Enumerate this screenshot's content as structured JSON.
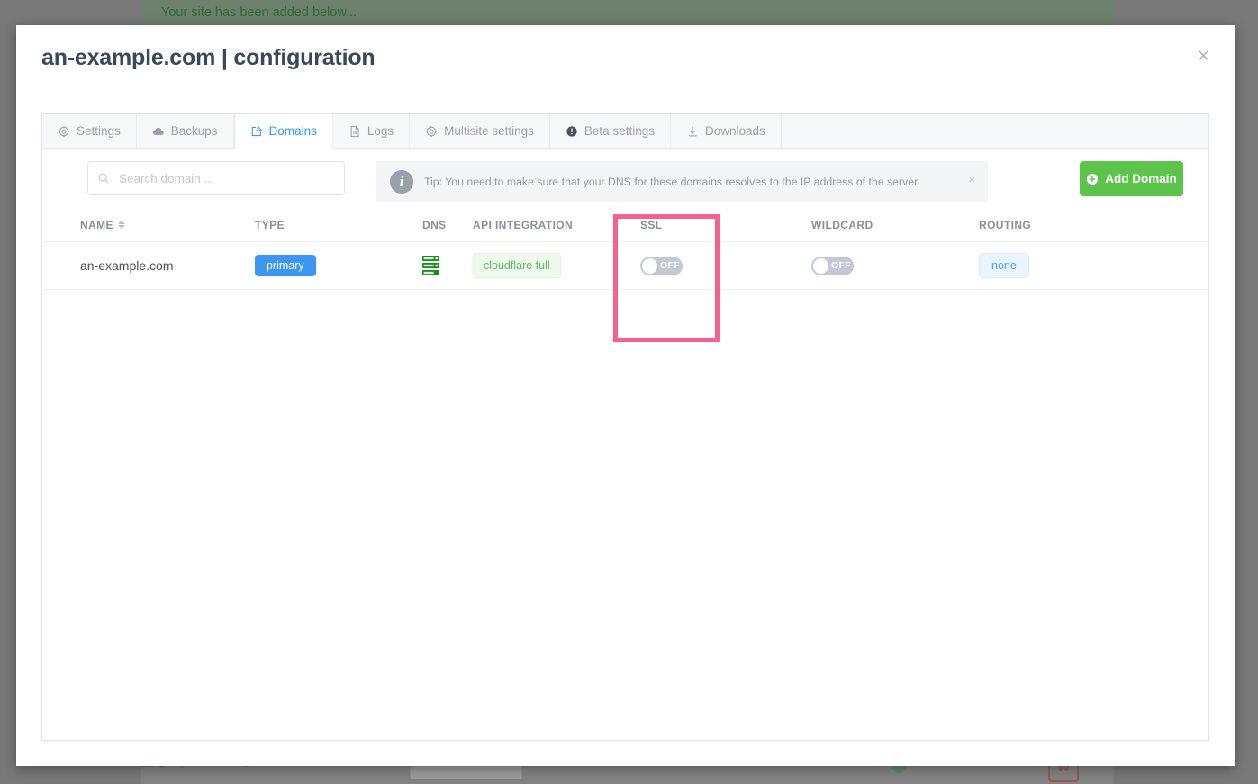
{
  "background": {
    "notice_text": "Your site has been added below...",
    "host_label": "gridpane.host",
    "footer_badge": "W"
  },
  "modal": {
    "title": "an-example.com | configuration",
    "close_icon": "close-icon"
  },
  "tabs": [
    {
      "label": "Settings",
      "icon": "gear-icon",
      "active": false
    },
    {
      "label": "Backups",
      "icon": "cloud-icon",
      "active": false
    },
    {
      "label": "Domains",
      "icon": "edit-square-icon",
      "active": true
    },
    {
      "label": "Logs",
      "icon": "document-icon",
      "active": false
    },
    {
      "label": "Multisite settings",
      "icon": "gear-icon",
      "active": false
    },
    {
      "label": "Beta settings",
      "icon": "exclamation-circle-icon",
      "active": false
    },
    {
      "label": "Downloads",
      "icon": "download-icon",
      "active": false
    }
  ],
  "toolbar": {
    "search_placeholder": "Search domain ...",
    "search_value": "",
    "search_icon": "search-icon",
    "tip_icon": "info-icon",
    "tip_text": "Tip: You need to make sure that your DNS for these domains resolves to the IP address of the server",
    "tip_close": "×",
    "add_domain_label": "Add Domain",
    "add_domain_icon": "plus-circle-icon"
  },
  "table": {
    "columns": [
      "NAME",
      "TYPE",
      "DNS",
      "API INTEGRATION",
      "SSL",
      "WILDCARD",
      "ROUTING"
    ],
    "sort_column": "NAME",
    "rows": [
      {
        "name": "an-example.com",
        "type": "primary",
        "dns_icon": "server-stack-icon",
        "api_integration": "cloudflare full",
        "ssl": "OFF",
        "ssl_enabled": false,
        "wildcard": "OFF",
        "wildcard_enabled": false,
        "routing": "none"
      }
    ]
  },
  "highlight": {
    "target_column": "SSL",
    "color": "#f75f8c"
  },
  "colors": {
    "accent_blue": "#3498f5",
    "primary_badge": "#3d97f2",
    "add_button_green": "#5cc44a",
    "dns_icon_green": "#1f8a20",
    "highlight_pink": "#f75f8c",
    "overlay_gray": "#787878"
  }
}
